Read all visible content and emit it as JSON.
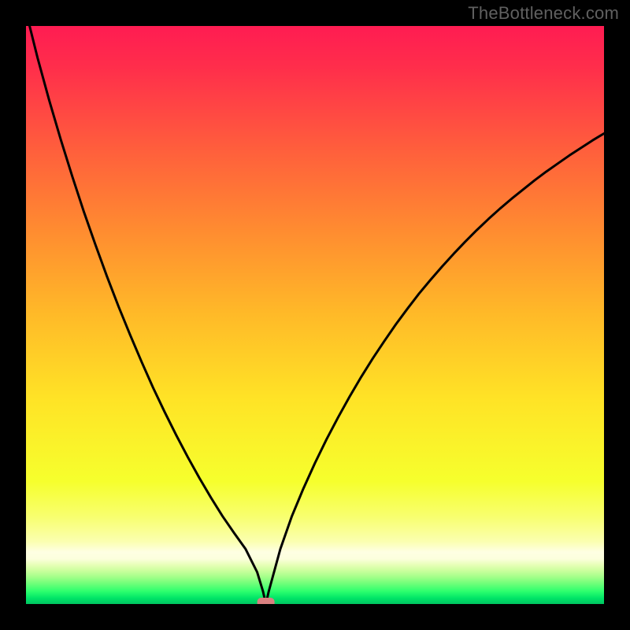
{
  "watermark": "TheBottleneck.com",
  "chart_data": {
    "type": "line",
    "title": "",
    "xlabel": "",
    "ylabel": "",
    "xlim": [
      0,
      1
    ],
    "ylim": [
      0,
      1
    ],
    "x": [
      0.0,
      0.02,
      0.04,
      0.06,
      0.08,
      0.1,
      0.12,
      0.14,
      0.16,
      0.18,
      0.2,
      0.22,
      0.24,
      0.26,
      0.28,
      0.3,
      0.32,
      0.34,
      0.36,
      0.38,
      0.4,
      0.41,
      0.415,
      0.42,
      0.44,
      0.46,
      0.48,
      0.5,
      0.52,
      0.54,
      0.56,
      0.58,
      0.6,
      0.62,
      0.64,
      0.66,
      0.68,
      0.7,
      0.72,
      0.74,
      0.76,
      0.78,
      0.8,
      0.82,
      0.84,
      0.86,
      0.88,
      0.9,
      0.92,
      0.94,
      0.96,
      0.98,
      1.0
    ],
    "y": [
      1.025,
      0.945,
      0.872,
      0.804,
      0.74,
      0.679,
      0.622,
      0.567,
      0.515,
      0.466,
      0.419,
      0.374,
      0.332,
      0.292,
      0.254,
      0.218,
      0.184,
      0.152,
      0.123,
      0.095,
      0.055,
      0.022,
      0.0,
      0.022,
      0.095,
      0.152,
      0.2,
      0.244,
      0.285,
      0.323,
      0.359,
      0.393,
      0.425,
      0.455,
      0.484,
      0.511,
      0.537,
      0.561,
      0.584,
      0.606,
      0.627,
      0.647,
      0.666,
      0.684,
      0.701,
      0.717,
      0.733,
      0.748,
      0.762,
      0.776,
      0.789,
      0.802,
      0.814
    ],
    "marker": {
      "x": 0.415,
      "y": 0.0
    },
    "gradient_stops": [
      {
        "offset": 0.0,
        "color": "#ff1c52"
      },
      {
        "offset": 0.072,
        "color": "#ff2e4b"
      },
      {
        "offset": 0.215,
        "color": "#ff5f3c"
      },
      {
        "offset": 0.358,
        "color": "#ff8d30"
      },
      {
        "offset": 0.5,
        "color": "#ffba28"
      },
      {
        "offset": 0.645,
        "color": "#ffe326"
      },
      {
        "offset": 0.788,
        "color": "#f6ff2d"
      },
      {
        "offset": 0.85,
        "color": "#f8ff70"
      },
      {
        "offset": 0.892,
        "color": "#fbffb0"
      },
      {
        "offset": 0.91,
        "color": "#feffe3"
      },
      {
        "offset": 0.922,
        "color": "#fcffdd"
      },
      {
        "offset": 0.932,
        "color": "#e7ffb8"
      },
      {
        "offset": 0.942,
        "color": "#ccff9e"
      },
      {
        "offset": 0.953,
        "color": "#a4ff8a"
      },
      {
        "offset": 0.965,
        "color": "#6dff79"
      },
      {
        "offset": 0.978,
        "color": "#2dff6e"
      },
      {
        "offset": 0.99,
        "color": "#00e467"
      },
      {
        "offset": 1.0,
        "color": "#00c661"
      }
    ]
  }
}
